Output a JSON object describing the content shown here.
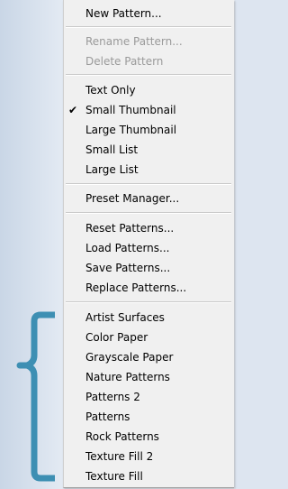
{
  "menu": {
    "group1": [
      {
        "label": "New Pattern...",
        "enabled": true
      }
    ],
    "group2": [
      {
        "label": "Rename Pattern...",
        "enabled": false
      },
      {
        "label": "Delete Pattern",
        "enabled": false
      }
    ],
    "group3": [
      {
        "label": "Text Only",
        "enabled": true,
        "checked": false
      },
      {
        "label": "Small Thumbnail",
        "enabled": true,
        "checked": true
      },
      {
        "label": "Large Thumbnail",
        "enabled": true,
        "checked": false
      },
      {
        "label": "Small List",
        "enabled": true,
        "checked": false
      },
      {
        "label": "Large List",
        "enabled": true,
        "checked": false
      }
    ],
    "group4": [
      {
        "label": "Preset Manager...",
        "enabled": true
      }
    ],
    "group5": [
      {
        "label": "Reset Patterns...",
        "enabled": true
      },
      {
        "label": "Load Patterns...",
        "enabled": true
      },
      {
        "label": "Save Patterns...",
        "enabled": true
      },
      {
        "label": "Replace Patterns...",
        "enabled": true
      }
    ],
    "group6": [
      {
        "label": "Artist Surfaces",
        "enabled": true
      },
      {
        "label": "Color Paper",
        "enabled": true
      },
      {
        "label": "Grayscale Paper",
        "enabled": true
      },
      {
        "label": "Nature Patterns",
        "enabled": true
      },
      {
        "label": "Patterns 2",
        "enabled": true
      },
      {
        "label": "Patterns",
        "enabled": true
      },
      {
        "label": "Rock Patterns",
        "enabled": true
      },
      {
        "label": "Texture Fill 2",
        "enabled": true
      },
      {
        "label": "Texture Fill",
        "enabled": true
      }
    ],
    "check_mark": "✔"
  },
  "colors": {
    "bracket": "#3d8fb3",
    "menu_background": "#f0f0f0",
    "disabled_text": "#9a9a9a"
  }
}
